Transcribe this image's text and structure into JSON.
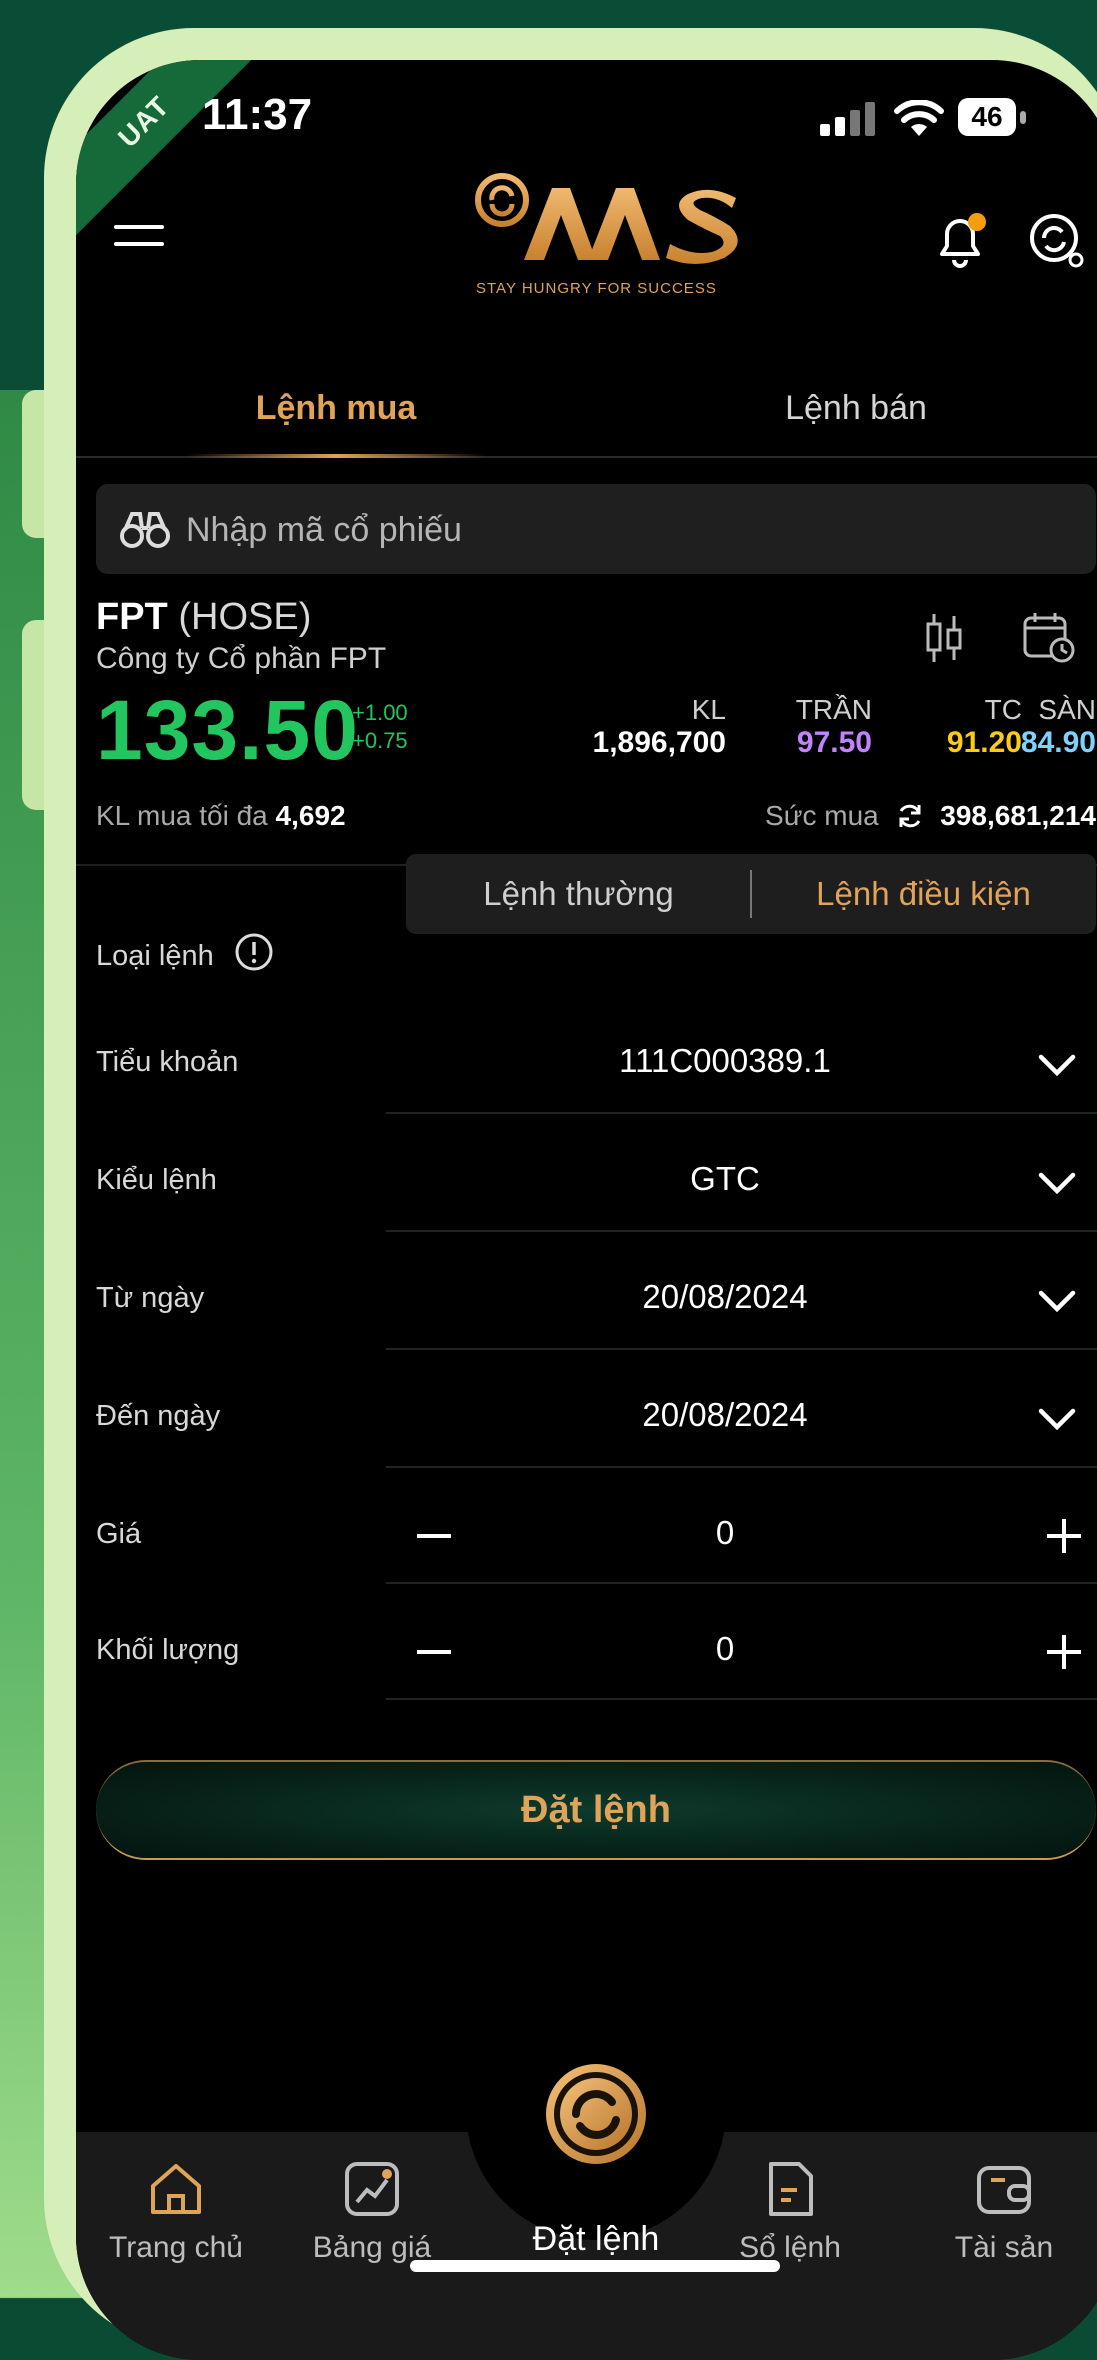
{
  "badge": "UAT",
  "status_bar": {
    "time": "11:37",
    "battery": "46"
  },
  "brand": {
    "name": "AAS",
    "slogan": "STAY HUNGRY FOR SUCCESS",
    "gold": "#e0a35a"
  },
  "tabs": {
    "buy": "Lệnh mua",
    "sell": "Lệnh bán"
  },
  "search": {
    "placeholder": "Nhập mã cổ phiếu"
  },
  "stock": {
    "symbol": "FPT",
    "exchange": "(HOSE)",
    "company": "Công ty Cổ phần FPT",
    "price": "133.50",
    "change": "+1.00",
    "change_pct": "+0.75",
    "stats": {
      "kl_label": "KL",
      "kl_value": "1,896,700",
      "ceiling_label": "TRẦN",
      "ceiling_value": "97.50",
      "ref_label": "TC",
      "ref_value": "91.20",
      "floor_label": "SÀN",
      "floor_value": "84.90"
    },
    "max_qty_label": "KL mua tối đa",
    "max_qty": "4,692",
    "buying_power_label": "Sức mua",
    "buying_power": "398,681,214"
  },
  "colors": {
    "up": "#22c55e",
    "ceiling": "#c084fc",
    "ref": "#facc15",
    "floor": "#7dd3fc"
  },
  "form": {
    "order_type_label": "Loại lệnh",
    "order_type_options": [
      "Lệnh thường",
      "Lệnh điều kiện"
    ],
    "order_type_selected": "Lệnh điều kiện",
    "sub_account_label": "Tiểu khoản",
    "sub_account": "111C000389.1",
    "order_kind_label": "Kiểu lệnh",
    "order_kind": "GTC",
    "from_date_label": "Từ ngày",
    "from_date": "20/08/2024",
    "to_date_label": "Đến ngày",
    "to_date": "20/08/2024",
    "price_label": "Giá",
    "price_value": "0",
    "qty_label": "Khối lượng",
    "qty_value": "0",
    "submit_label": "Đặt lệnh"
  },
  "tabbar": {
    "items": [
      "Trang chủ",
      "Bảng giá",
      "Đặt lệnh",
      "Sổ lệnh",
      "Tài sản"
    ],
    "active": "Đặt lệnh"
  }
}
